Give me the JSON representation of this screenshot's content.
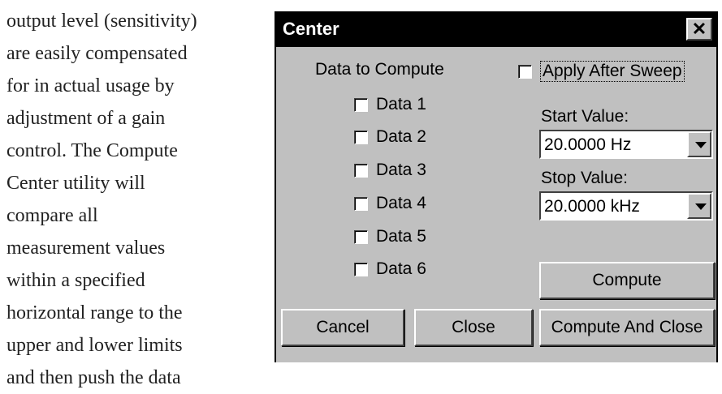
{
  "doc": {
    "lines": [
      "output level (sensitivity)",
      "are easily compensated",
      "for in actual usage by",
      "adjustment of a gain",
      "control.  The Compute",
      "Center utility will",
      "compare all",
      "measurement values",
      "within a specified",
      "horizontal range to the",
      "upper and lower limits",
      "and then push the data"
    ]
  },
  "dialog": {
    "title": "Center",
    "close_glyph": "✕",
    "data_to_compute_label": "Data to Compute",
    "data_items": [
      {
        "label": "Data 1",
        "checked": false
      },
      {
        "label": "Data 2",
        "checked": false
      },
      {
        "label": "Data 3",
        "checked": false
      },
      {
        "label": "Data 4",
        "checked": false
      },
      {
        "label": "Data 5",
        "checked": false
      },
      {
        "label": "Data 6",
        "checked": false
      }
    ],
    "apply_after_sweep": {
      "label": "Apply After Sweep",
      "checked": false
    },
    "start_value": {
      "label": "Start Value:",
      "value": "20.0000  Hz"
    },
    "stop_value": {
      "label": "Stop Value:",
      "value": "20.0000 kHz"
    },
    "buttons": {
      "compute": {
        "pre": "Comp",
        "ul": "u",
        "post": "te"
      },
      "cancel": {
        "pre": "",
        "ul": "C",
        "post": "ancel"
      },
      "close": {
        "pre": "Cl",
        "ul": "o",
        "post": "se"
      },
      "compute_and_close": {
        "pre": "Compute ",
        "ul": "A",
        "post": "nd Close"
      }
    }
  }
}
